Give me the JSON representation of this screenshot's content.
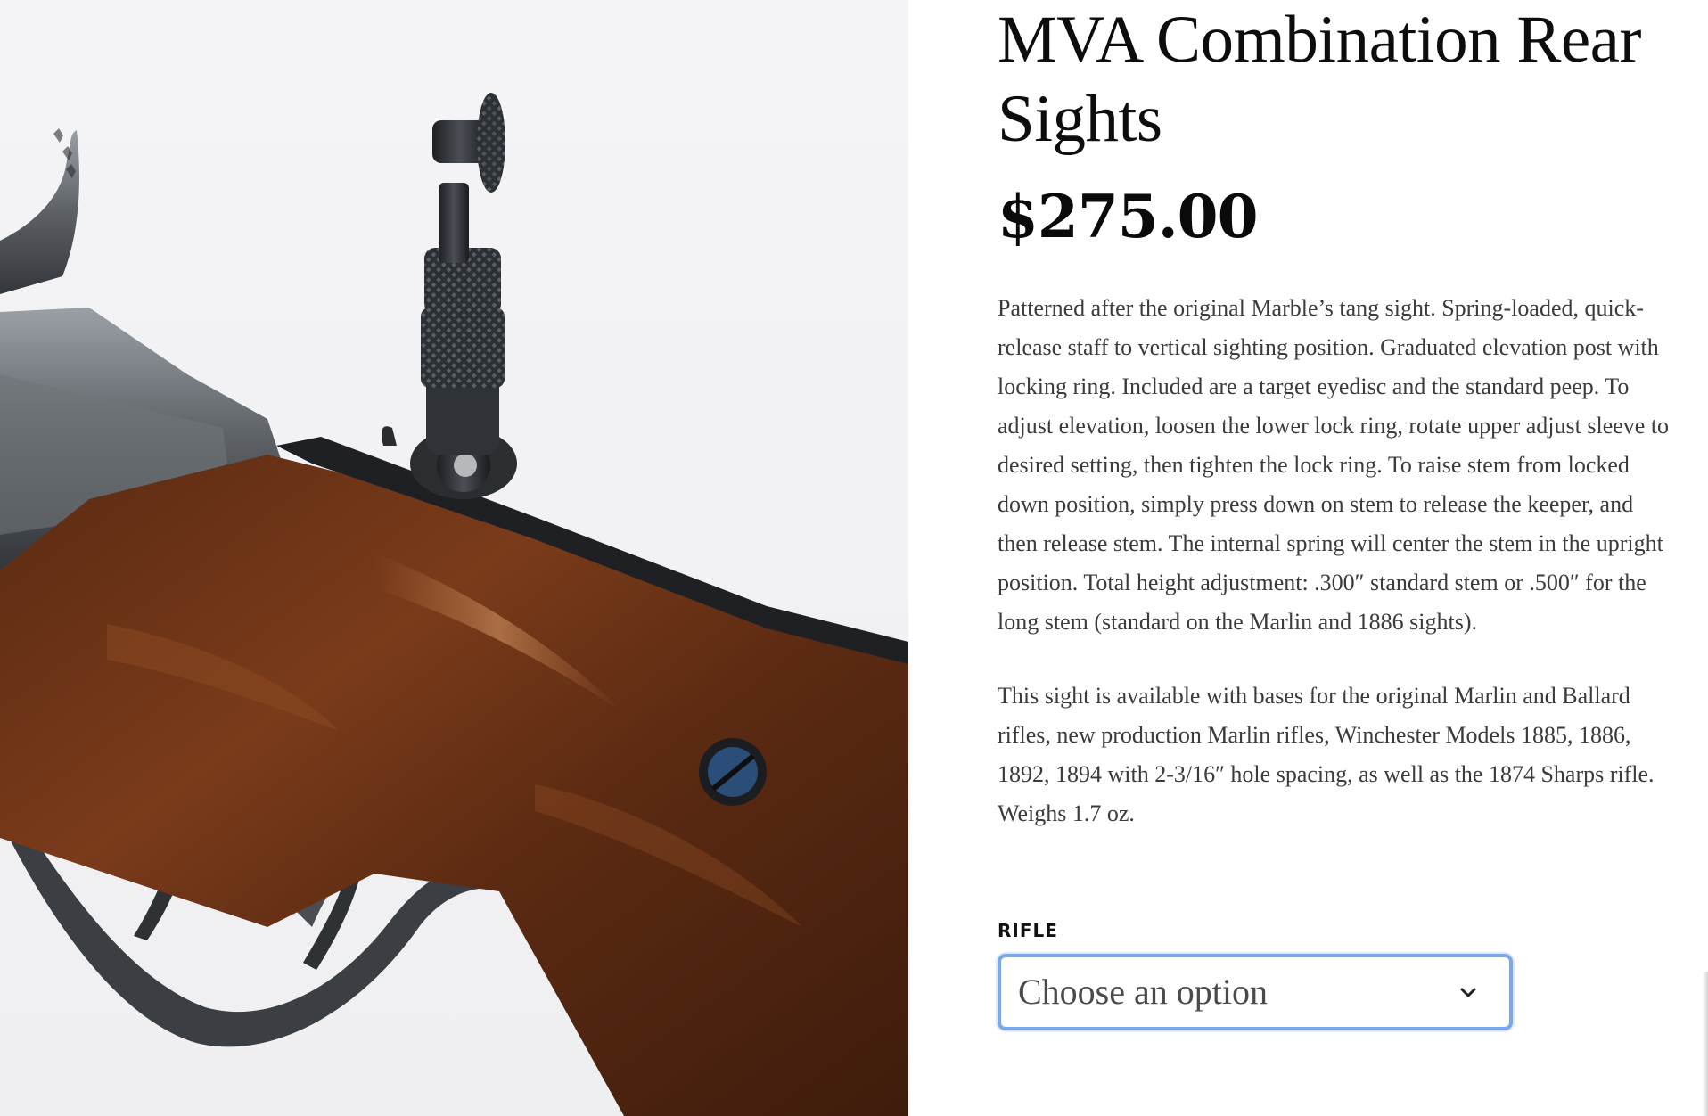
{
  "product": {
    "title": "MVA Combination Rear Sights",
    "price": "$275.00",
    "image_alt": "Rifle with combination rear tang sight",
    "description": [
      "Patterned after the original Marble’s tang sight. Spring-loaded, quick-release staff to vertical sighting position. Graduated elevation post with locking ring. Included are a target eyedisc and the standard peep. To adjust elevation, loosen the lower lock ring, rotate upper adjust sleeve to desired setting, then tighten the lock ring. To raise stem from locked down position, simply press down on stem to release the keeper, and then release stem. The internal spring will center the stem in the upright position. Total height adjustment: .300″ standard stem or .500″ for the long stem (standard on the Marlin and 1886 sights).",
      "This sight is available with bases for the original Marlin and Ballard rifles, new production Marlin rifles, Winchester Models 1885, 1886, 1892, 1894 with 2-3/16″ hole spacing, as well as the 1874 Sharps rifle. Weighs 1.7 oz."
    ]
  },
  "variations": {
    "rifle_label": "RIFLE",
    "rifle_select_value": "Choose an option",
    "select_icon": "chevron-down-icon",
    "focus_color": "#7aa8ea"
  }
}
